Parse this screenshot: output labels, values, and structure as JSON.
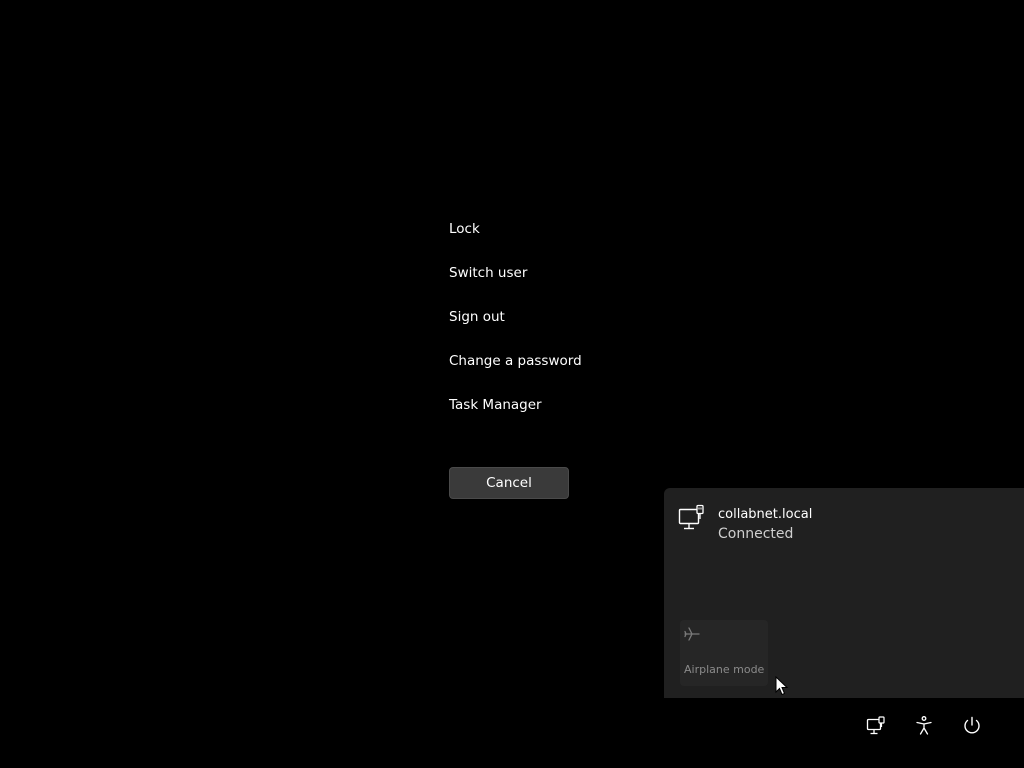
{
  "menu": {
    "items": [
      {
        "label": "Lock"
      },
      {
        "label": "Switch user"
      },
      {
        "label": "Sign out"
      },
      {
        "label": "Change a password"
      },
      {
        "label": "Task Manager"
      }
    ],
    "cancel_label": "Cancel"
  },
  "network_flyout": {
    "network_name": "collabnet.local",
    "network_status": "Connected",
    "network_icon": "wired-network-icon",
    "airplane_mode_label": "Airplane mode",
    "airplane_icon": "airplane-icon"
  },
  "system_tray": {
    "icons": [
      "network-icon",
      "accessibility-icon",
      "power-icon"
    ]
  },
  "colors": {
    "background": "#000000",
    "flyout_background": "#202020",
    "cancel_button": "#3a3a3a",
    "disabled_text": "#8a8a8a"
  }
}
